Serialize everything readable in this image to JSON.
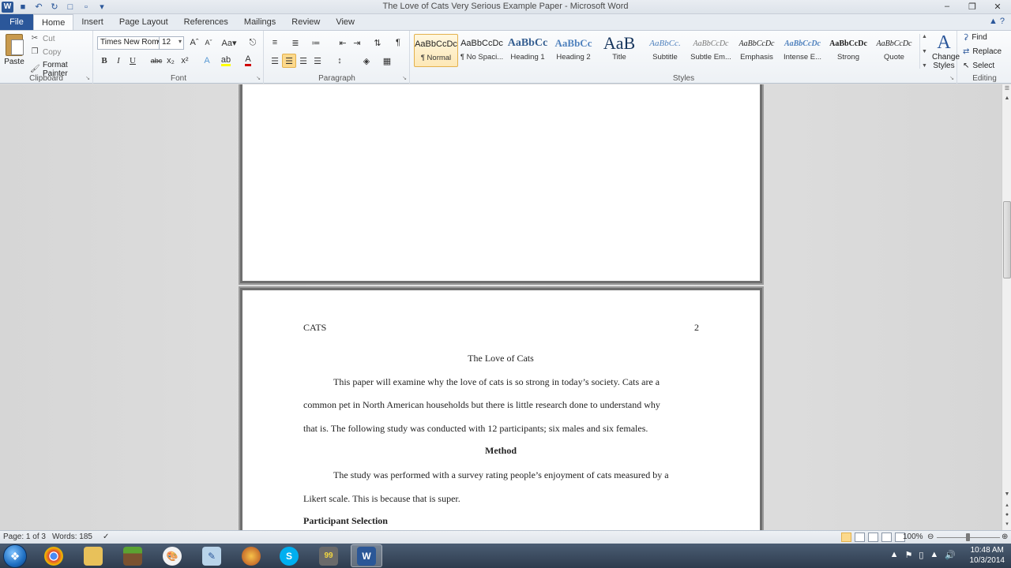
{
  "window": {
    "title": "The Love of Cats Very Serious Example Paper - Microsoft Word"
  },
  "tabs": [
    "File",
    "Home",
    "Insert",
    "Page Layout",
    "References",
    "Mailings",
    "Review",
    "View"
  ],
  "ribbon": {
    "clipboard": {
      "label": "Clipboard",
      "paste": "Paste",
      "cut": "Cut",
      "copy": "Copy",
      "format_painter": "Format Painter"
    },
    "font": {
      "label": "Font",
      "font_name": "Times New Rom",
      "font_size": "12"
    },
    "paragraph": {
      "label": "Paragraph"
    },
    "styles": {
      "label": "Styles",
      "items": [
        {
          "sample": "AaBbCcDc",
          "name": "¶ Normal"
        },
        {
          "sample": "AaBbCcDc",
          "name": "¶ No Spaci..."
        },
        {
          "sample": "AaBbCc",
          "name": "Heading 1"
        },
        {
          "sample": "AaBbCc",
          "name": "Heading 2"
        },
        {
          "sample": "AaB",
          "name": "Title"
        },
        {
          "sample": "AaBbCc.",
          "name": "Subtitle"
        },
        {
          "sample": "AaBbCcDc",
          "name": "Subtle Em..."
        },
        {
          "sample": "AaBbCcDc",
          "name": "Emphasis"
        },
        {
          "sample": "AaBbCcDc",
          "name": "Intense E..."
        },
        {
          "sample": "AaBbCcDc",
          "name": "Strong"
        },
        {
          "sample": "AaBbCcDc",
          "name": "Quote"
        }
      ],
      "change_styles": "Change Styles"
    },
    "editing": {
      "label": "Editing",
      "find": "Find",
      "replace": "Replace",
      "select": "Select"
    }
  },
  "document": {
    "page2": {
      "running_head": "CATS",
      "page_number": "2",
      "title": "The Love of Cats",
      "intro_lines": [
        "This paper will examine why the love of cats is so strong in today’s society.  Cats are a",
        "common pet in North American households but there is little research done to understand why",
        "that is.  The following study was conducted with 12 participants; six males and six females."
      ],
      "method_heading": "Method",
      "method_lines": [
        "The study was performed with a survey rating people’s enjoyment of cats measured by a",
        "Likert scale.  This is because that is super."
      ],
      "participant_heading": "Participant Selection"
    }
  },
  "status": {
    "page": "Page: 1 of 3",
    "words": "Words: 185",
    "zoom": "100%"
  },
  "taskbar": {
    "clock_time": "10:48 AM",
    "clock_date": "10/3/2014"
  }
}
